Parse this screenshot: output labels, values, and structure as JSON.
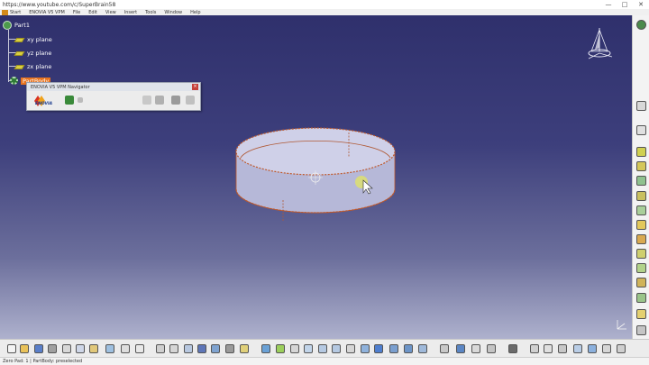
{
  "window": {
    "url": "https://www.youtube.com/c/SuperBrain58",
    "controls": [
      "—",
      "□",
      "✕"
    ]
  },
  "menu": {
    "items": [
      "Start",
      "ENOVIA V5 VPM",
      "File",
      "Edit",
      "View",
      "Insert",
      "Tools",
      "Window",
      "Help"
    ]
  },
  "tree": {
    "root": "Part1",
    "planes": [
      "xy plane",
      "yz plane",
      "zx plane"
    ],
    "body": "PartBody"
  },
  "navigator": {
    "title": "ENOVIA V5 VPM Navigator",
    "logo": "ENOVIA"
  },
  "status": {
    "text": "Zero Pad: 1 | PartBody: preselected"
  },
  "colors": {
    "viewport_top": "#2f306c",
    "viewport_bottom": "#aeb1cd",
    "highlight": "#e8731f",
    "cylinder_face": "#c8c9e3",
    "cylinder_edge": "#c0582a"
  },
  "icons": {
    "compass": "compass-icon",
    "cursor": "mouse-pointer-icon"
  }
}
